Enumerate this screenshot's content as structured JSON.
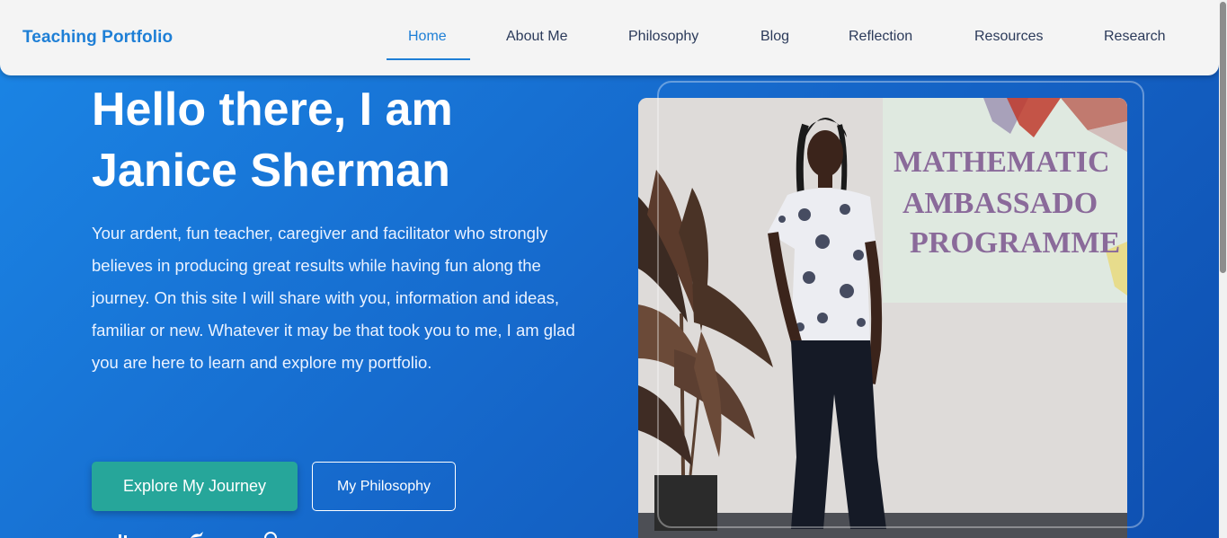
{
  "navbar": {
    "brand": "Teaching Portfolio",
    "items": [
      {
        "label": "Home",
        "active": true
      },
      {
        "label": "About Me",
        "active": false
      },
      {
        "label": "Philosophy",
        "active": false
      },
      {
        "label": "Blog",
        "active": false
      },
      {
        "label": "Reflection",
        "active": false
      },
      {
        "label": "Resources",
        "active": false
      },
      {
        "label": "Research",
        "active": false
      }
    ]
  },
  "hero": {
    "title_line1": "Hello there, I am",
    "title_line2": "Janice Sherman",
    "description": "Your ardent, fun teacher, caregiver and facilitator who strongly believes in producing great results while having fun along the journey. On this site I will share with you, information and ideas, familiar or new. Whatever it may be that took you to me, I am glad you are here to learn and explore my portfolio.",
    "primary_button": "Explore My Journey",
    "secondary_button": "My Philosophy"
  },
  "photo": {
    "banner_line1": "MATHEMATIC",
    "banner_line2": "AMBASSADO",
    "banner_line3": "PROGRAMME"
  },
  "colors": {
    "brand": "#1e7fd6",
    "nav_text": "#2b3a5a",
    "hero_gradient_start": "#1b86e6",
    "hero_gradient_end": "#0e4fb0",
    "primary_button": "#26a69a",
    "banner_text": "#8a6a9a"
  }
}
